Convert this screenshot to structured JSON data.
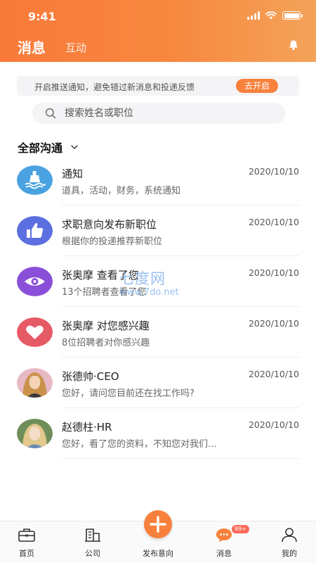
{
  "status_bar": {
    "time": "9:41"
  },
  "header": {
    "title": "消息",
    "tab_interaction": "互动"
  },
  "notice": {
    "text": "开启推送通知，避免错过新消息和投递反馈",
    "button": "去开启"
  },
  "search": {
    "placeholder": "搜索姓名或职位"
  },
  "filter": {
    "label": "全部沟通"
  },
  "messages": [
    {
      "name": "通知",
      "preview": "道具，活动，财务，系统通知",
      "time": "2020/10/10",
      "avatar": "notification-icon"
    },
    {
      "name": "求职意向发布新职位",
      "preview": "根据你的投递推荐新职位",
      "time": "2020/10/10",
      "avatar": "thumbs-up-icon"
    },
    {
      "name": "张奥摩  查看了您",
      "preview": "13个招聘者查看了您",
      "time": "2020/10/10",
      "avatar": "eye-icon"
    },
    {
      "name": "张奥摩  对您感兴趣",
      "preview": "8位招聘者对你感兴趣",
      "time": "2020/10/10",
      "avatar": "heart-icon"
    },
    {
      "name": "张德帅·CEO",
      "preview": "您好，请问您目前还在找工作吗?",
      "time": "2020/10/10",
      "avatar": "user-photo"
    },
    {
      "name": "赵德柱·HR",
      "preview": "您好，看了您的资料，不知您对我们…",
      "time": "2020/10/10",
      "avatar": "user-photo"
    }
  ],
  "watermark": {
    "line1": "七度网",
    "line2": "www.7do.net"
  },
  "tabbar": {
    "home": "首页",
    "company": "公司",
    "publish": "发布意向",
    "messages": "消息",
    "messages_badge": "99+",
    "mine": "我的"
  },
  "colors": {
    "accent": "#f7813c",
    "avatar_notify": "#4aa3e0",
    "avatar_thumb": "#5b6fe0",
    "avatar_eye": "#8a4fd8",
    "avatar_heart": "#e65a66"
  }
}
